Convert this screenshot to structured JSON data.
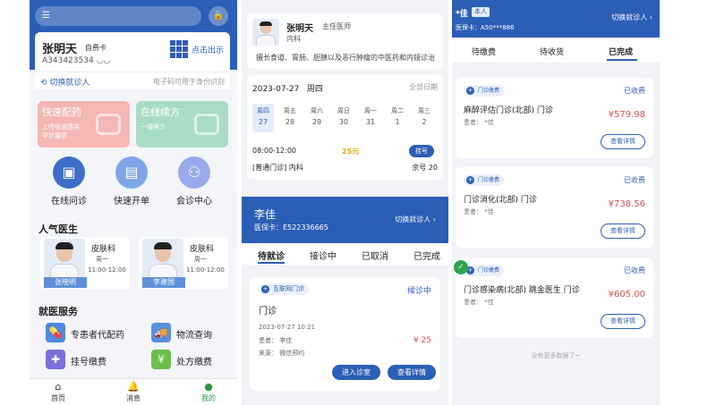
{
  "panel1": {
    "patient_name": "张明天",
    "patient_tag": "自费卡",
    "patient_card": "A343423534",
    "qr_label": "点击出示",
    "switch_label": "切换就诊人",
    "ecode_hint": "电子码可用于身份识别",
    "promos": [
      {
        "title": "快速配药",
        "subtitle": "上呼吸道感染\n甲状腺感"
      },
      {
        "title": "在线续方",
        "subtitle": "一键续方"
      }
    ],
    "services": [
      {
        "label": "在线问诊",
        "icon": "calendar-icon",
        "color": "#3e6fc8"
      },
      {
        "label": "快速开单",
        "icon": "order-form-icon",
        "color": "#7ea6e6"
      },
      {
        "label": "会诊中心",
        "icon": "group-icon",
        "color": "#9aa9ea"
      }
    ],
    "popular_title": "人气医生",
    "doctors": [
      {
        "name": "张晓明",
        "dept": "皮肤科",
        "day": "周一",
        "time": "11:00-12:00"
      },
      {
        "name": "李建国",
        "dept": "皮肤科",
        "day": "周一",
        "time": "11:00-12:00"
      }
    ],
    "medical_title": "就医服务",
    "medical_items": [
      {
        "label": "专患者代配药",
        "icon": "pill-icon",
        "color": "#4f88e0"
      },
      {
        "label": "物流查询",
        "icon": "truck-icon",
        "color": "#5b8fe0"
      },
      {
        "label": "挂号缴费",
        "icon": "plus-register-icon",
        "color": "#7b6fd9"
      },
      {
        "label": "处方缴费",
        "icon": "prescription-icon",
        "color": "#6cc04a"
      }
    ],
    "tabbar": [
      {
        "label": "首页",
        "icon": "home-icon"
      },
      {
        "label": "消息",
        "icon": "bell-icon"
      },
      {
        "label": "我的",
        "icon": "user-icon"
      }
    ]
  },
  "panel2": {
    "doctor_name": "张明天",
    "doctor_title": "主任医师",
    "doctor_dept": "内科",
    "doctor_specialty": "擅长食道、胃肠、胆胰以及恶行肿瘤的中医药和内镜诊治",
    "schedule_date": "2023-07-27",
    "schedule_weekday": "周四",
    "all_dates": "全部日期",
    "days": [
      {
        "w": "周四",
        "d": "27",
        "active": true
      },
      {
        "w": "周五",
        "d": "28"
      },
      {
        "w": "周六",
        "d": "29"
      },
      {
        "w": "周日",
        "d": "30"
      },
      {
        "w": "周一",
        "d": "31"
      },
      {
        "w": "周二",
        "d": "1"
      },
      {
        "w": "周三",
        "d": "2"
      }
    ],
    "slot_time": "08:00-12:00",
    "slot_price": "25元",
    "register_label": "挂号",
    "slot_dept": "[普通门诊] 内科",
    "slot_remaining": "余号 20",
    "patient_name": "李佳",
    "patient_card": "医保卡：E522336665",
    "switch_label": "切换就诊人",
    "tabs": [
      "待就诊",
      "接诊中",
      "已取消",
      "已完成"
    ],
    "visit": {
      "badge": "互联网门诊",
      "state": "候诊中",
      "title": "门诊",
      "datetime": "2023-07-27 10:21",
      "patient": "患者：  李佳",
      "source": "来源：  微信预约",
      "price": "¥ 25",
      "enter_btn": "进入诊室",
      "detail_btn": "查看详情"
    }
  },
  "panel3": {
    "patient_name": "*佳",
    "patient_tag": "本人",
    "patient_card": "医保卡：A50***886",
    "switch_label": "切换就诊人",
    "tabs": [
      "待缴费",
      "待收货",
      "已完成"
    ],
    "orders": [
      {
        "badge": "门诊缴费",
        "status": "已收费",
        "title": "麻醉评估门诊(北部) 门诊",
        "patient": "患者：  *佳",
        "price": "¥579.98",
        "btn": "查看详情"
      },
      {
        "badge": "门诊缴费",
        "status": "已收费",
        "title": "门诊消化(北部) 门诊",
        "patient": "患者：  *佳",
        "price": "¥738.56",
        "btn": "查看详情"
      },
      {
        "badge": "门诊缴费",
        "status": "已收费",
        "title": "门诊感染病(北部) 跳金医生 门诊",
        "patient": "患者：  *佳",
        "price": "¥605.00",
        "btn": "查看详情"
      }
    ],
    "no_more": "没有更多数据了~"
  }
}
